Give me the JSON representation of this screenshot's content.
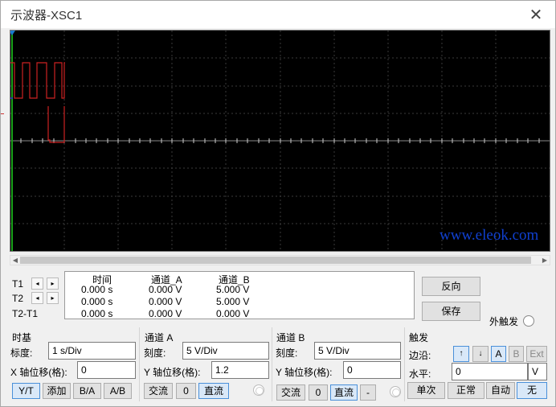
{
  "window": {
    "title": "示波器-XSC1",
    "close_glyph": "✕"
  },
  "watermark": "www.eleok.com",
  "cursors": {
    "t1": "T1",
    "t2": "T2",
    "t2_t1": "T2-T1",
    "left_glyph": "◂",
    "right_glyph": "▸"
  },
  "readout": {
    "headers": {
      "time": "时间",
      "channel_a": "通道_A",
      "channel_b": "通道_B"
    },
    "rows": [
      {
        "time": "0.000 s",
        "a": "0.000 V",
        "b": "5.000 V"
      },
      {
        "time": "0.000 s",
        "a": "0.000 V",
        "b": "5.000 V"
      },
      {
        "time": "0.000 s",
        "a": "0.000 V",
        "b": "0.000 V"
      }
    ]
  },
  "actions": {
    "reverse": "反向",
    "save": "保存",
    "ext_trigger": "外触发"
  },
  "timebase": {
    "title": "时基",
    "scale_label": "标度:",
    "scale_value": "1  s/Div",
    "xpos_label": "X 轴位移(格):",
    "xpos_value": "0",
    "modes": [
      "Y/T",
      "添加",
      "B/A",
      "A/B"
    ]
  },
  "channel_a": {
    "title": "通道 A",
    "scale_label": "刻度:",
    "scale_value": "5  V/Div",
    "ypos_label": "Y 轴位移(格):",
    "ypos_value": "1.2",
    "coupling": [
      "交流",
      "0",
      "直流"
    ]
  },
  "channel_b": {
    "title": "通道 B",
    "scale_label": "刻度:",
    "scale_value": "5  V/Div",
    "ypos_label": "Y 轴位移(格):",
    "ypos_value": "0",
    "coupling": [
      "交流",
      "0",
      "直流",
      "-"
    ]
  },
  "trigger": {
    "title": "触发",
    "edge_label": "边沿:",
    "edge_rising": "↑",
    "edge_falling": "↓",
    "sources": [
      "A",
      "B",
      "Ext"
    ],
    "level_label": "水平:",
    "level_value": "0",
    "level_unit": "V",
    "modes": [
      "单次",
      "正常",
      "自动",
      "无"
    ]
  },
  "colors": {
    "channel_a": "#cc2222",
    "channel_b": "#2a2ad0",
    "screen_bg": "#000000",
    "selected_border": "#4a90d9",
    "watermark": "#1040d0"
  }
}
